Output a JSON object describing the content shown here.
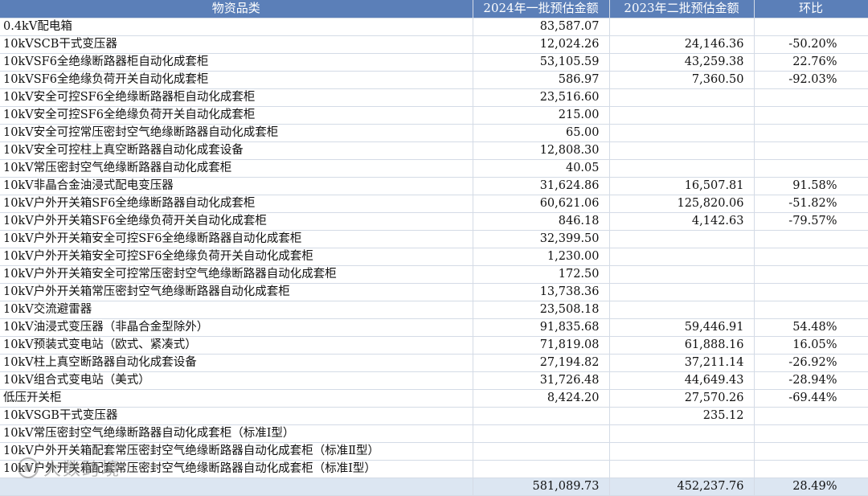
{
  "table": {
    "headers": [
      "物资品类",
      "2024年一批预估金额",
      "2023年二批预估金额",
      "环比"
    ],
    "rows": [
      [
        "0.4kV配电箱",
        "83,587.07",
        "",
        ""
      ],
      [
        "10kVSCB干式变压器",
        "12,024.26",
        "24,146.36",
        "-50.20%"
      ],
      [
        "10kVSF6全绝缘断路器柜自动化成套柜",
        "53,105.59",
        "43,259.38",
        "22.76%"
      ],
      [
        "10kVSF6全绝缘负荷开关自动化成套柜",
        "586.97",
        "7,360.50",
        "-92.03%"
      ],
      [
        "10kV安全可控SF6全绝缘断路器柜自动化成套柜",
        "23,516.60",
        "",
        ""
      ],
      [
        "10kV安全可控SF6全绝缘负荷开关自动化成套柜",
        "215.00",
        "",
        ""
      ],
      [
        "10kV安全可控常压密封空气绝缘断路器自动化成套柜",
        "65.00",
        "",
        ""
      ],
      [
        "10kV安全可控柱上真空断路器自动化成套设备",
        "12,808.30",
        "",
        ""
      ],
      [
        "10kV常压密封空气绝缘断路器自动化成套柜",
        "40.05",
        "",
        ""
      ],
      [
        "10kV非晶合金油浸式配电变压器",
        "31,624.86",
        "16,507.81",
        "91.58%"
      ],
      [
        "10kV户外开关箱SF6全绝缘断路器自动化成套柜",
        "60,621.06",
        "125,820.06",
        "-51.82%"
      ],
      [
        "10kV户外开关箱SF6全绝缘负荷开关自动化成套柜",
        "846.18",
        "4,142.63",
        "-79.57%"
      ],
      [
        "10kV户外开关箱安全可控SF6全绝缘断路器自动化成套柜",
        "32,399.50",
        "",
        ""
      ],
      [
        "10kV户外开关箱安全可控SF6全绝缘负荷开关自动化成套柜",
        "1,230.00",
        "",
        ""
      ],
      [
        "10kV户外开关箱安全可控常压密封空气绝缘断路器自动化成套柜",
        "172.50",
        "",
        ""
      ],
      [
        "10kV户外开关箱常压密封空气绝缘断路器自动化成套柜",
        "13,738.36",
        "",
        ""
      ],
      [
        "10kV交流避雷器",
        "23,508.18",
        "",
        ""
      ],
      [
        "10kV油浸式变压器（非晶合金型除外）",
        "91,835.68",
        "59,446.91",
        "54.48%"
      ],
      [
        "10kV预装式变电站（欧式、紧凑式）",
        "71,819.08",
        "61,888.16",
        "16.05%"
      ],
      [
        "10kV柱上真空断路器自动化成套设备",
        "27,194.82",
        "37,211.14",
        "-26.92%"
      ],
      [
        "10kV组合式变电站（美式）",
        "31,726.48",
        "44,649.43",
        "-28.94%"
      ],
      [
        "低压开关柜",
        "8,424.20",
        "27,570.26",
        "-69.44%"
      ],
      [
        "10kVSGB干式变压器",
        "",
        "235.12",
        ""
      ],
      [
        "10kV常压密封空气绝缘断路器自动化成套柜（标准Ⅰ型）",
        "",
        "",
        ""
      ],
      [
        "10kV户外开关箱配套常压密封空气绝缘断路器自动化成套柜（标准Ⅱ型）",
        "",
        "",
        ""
      ],
      [
        "10kV户外开关箱配套常压密封空气绝缘断路器自动化成套柜（标准Ⅰ型）",
        "",
        "",
        ""
      ]
    ],
    "total": [
      "",
      "581,089.73",
      "452,237.76",
      "28.49%"
    ],
    "header_bg": "#5b7fb8",
    "total_bg": "#dce6f2"
  },
  "watermark": {
    "text": "大数跨境",
    "icon": "brand-logo-icon"
  }
}
